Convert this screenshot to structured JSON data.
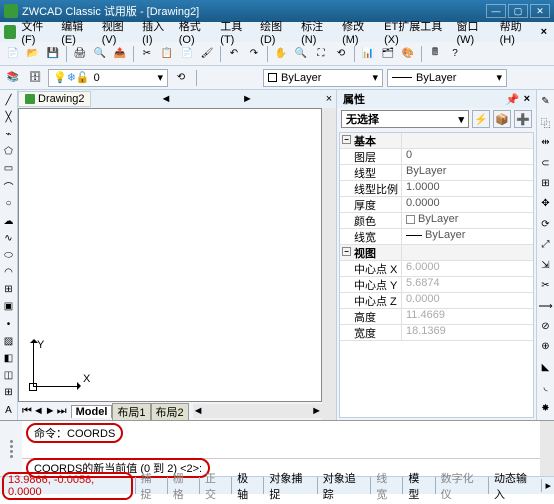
{
  "titlebar": {
    "title": "ZWCAD Classic 试用版 - [Drawing2]"
  },
  "menu": [
    "文件(F)",
    "编辑(E)",
    "视图(V)",
    "插入(I)",
    "格式(O)",
    "工具(T)",
    "绘图(D)",
    "标注(N)",
    "修改(M)",
    "ET扩展工具(X)",
    "窗口(W)",
    "帮助(H)"
  ],
  "doc": {
    "tab": "Drawing2"
  },
  "layerbar": {
    "current": "0",
    "bylayer1": "ByLayer",
    "bylayer2": "ByLayer"
  },
  "layout_tabs": {
    "model": "Model",
    "l1": "布局1",
    "l2": "布局2"
  },
  "props": {
    "title": "属性",
    "selection": "无选择",
    "groups": {
      "basic": "基本",
      "view": "视图"
    },
    "rows": {
      "layer_k": "图层",
      "layer_v": "0",
      "ltype_k": "线型",
      "ltype_v": "ByLayer",
      "ltscale_k": "线型比例",
      "ltscale_v": "1.0000",
      "thick_k": "厚度",
      "thick_v": "0.0000",
      "color_k": "颜色",
      "color_v": "ByLayer",
      "lw_k": "线宽",
      "lw_v": "ByLayer",
      "cx_k": "中心点 X",
      "cx_v": "6.0000",
      "cy_k": "中心点 Y",
      "cy_v": "5.6874",
      "cz_k": "中心点 Z",
      "cz_v": "0.0000",
      "h_k": "高度",
      "h_v": "11.4669",
      "w_k": "宽度",
      "w_v": "18.1369"
    }
  },
  "cmd": {
    "line": "命令：COORDS",
    "prompt": "COORDS的新当前值 (0 到 2) <2>:"
  },
  "status": {
    "coords": "13.9866, -0.0058, 0.0000",
    "cells": [
      "捕捉",
      "栅格",
      "正交",
      "极轴",
      "对象捕捉",
      "对象追踪",
      "线宽",
      "模型",
      "数字化仪",
      "动态输入"
    ]
  },
  "ucs": {
    "x": "X",
    "y": "Y"
  }
}
